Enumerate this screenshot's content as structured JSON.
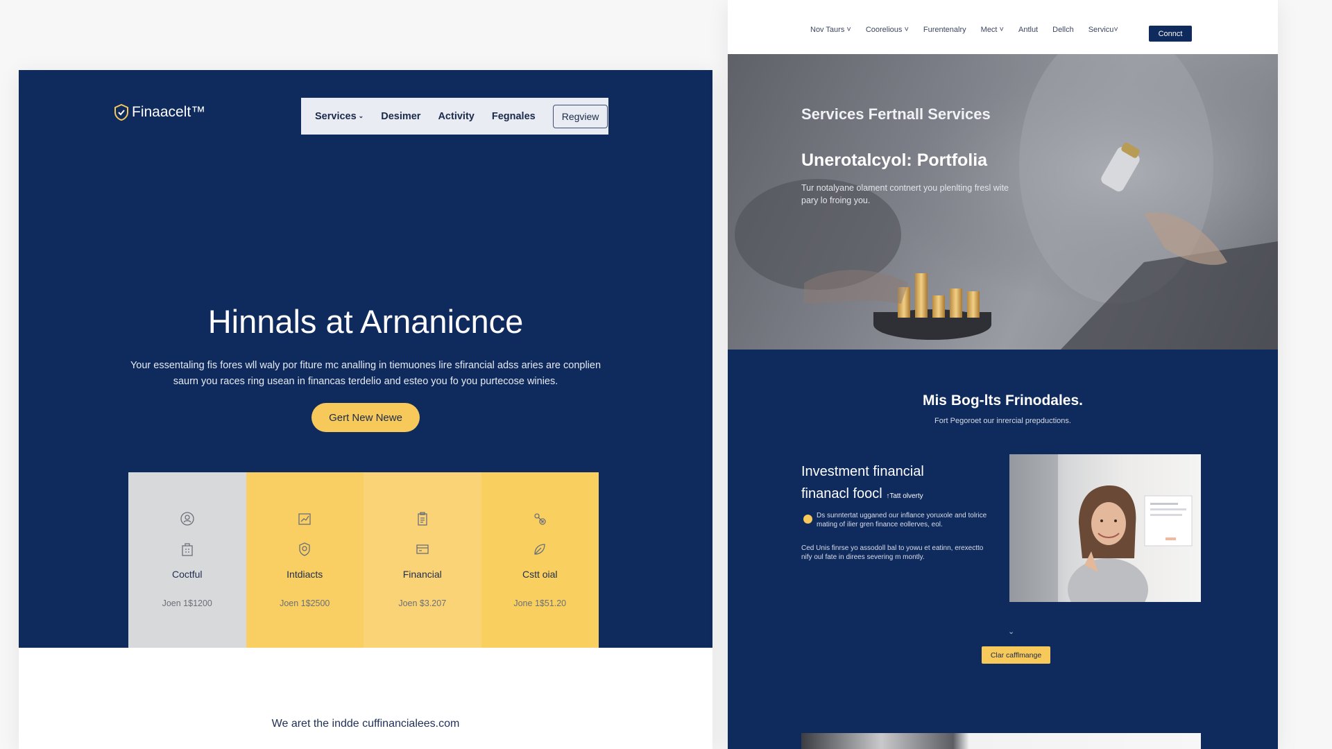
{
  "left_page": {
    "logo_text": "Finaacelt™",
    "nav": {
      "items": [
        "Services",
        "Desimer",
        "Activity",
        "Fegnales"
      ],
      "button": "Regview"
    },
    "hero": {
      "title": "Hinnals at Arnanicnce",
      "description": "Your essentaling fis fores wll waly por fiture mc analling in tiemuones lire sfirancial adss aries are conplien saurn you races ring usean in financas terdelio and esteo you fo you purtecose winies.",
      "cta": "Gert New Newe"
    },
    "cards": [
      {
        "title": "Coctful",
        "price": "Joen 1$1200"
      },
      {
        "title": "Intdiacts",
        "price": "Joen 1$2500"
      },
      {
        "title": "Financial",
        "price": "Joen $3.207"
      },
      {
        "title": "Cstt oial",
        "price": "Jone 1$51.20"
      }
    ],
    "footer_text": "We aret the indde cuffinancialees.com"
  },
  "right_page": {
    "nav": {
      "items": [
        "Nov Taurs ˅",
        "Coorelious ˅",
        "Furentenalry",
        "Mect ˅",
        "Antlut",
        "Dellch",
        "Servicu˅"
      ],
      "button": "Connct"
    },
    "hero": {
      "title": "Services Fertnall Services",
      "subtitle": "Unerotalcyol: Portfolia",
      "description": "Tur notalyane olament contnert you plenlting fresl wite pary lo froing you."
    },
    "section": {
      "title": "Mis Bog-lts Frinodales.",
      "subtitle": "Fort Pegoroet our inrercial prepductions."
    },
    "feature": {
      "title_line1": "Investment financial",
      "title_line2": "finanacl foocl",
      "tag": "↑Tatt olverty",
      "body1": "Ds sunntertat ugganed our inflance yoruxole and tolrice mating of ilier gren finance eollerves, eol.",
      "body2": "Ced Unis finrse yo assodoll bal to yowu et eatinn, erexectto nify oul fate in direes severing m montly."
    },
    "cta": "Clar cafflmange"
  },
  "colors": {
    "navy": "#0f2a5c",
    "gold": "#f6c95a",
    "light_gray": "#d8d9db"
  }
}
